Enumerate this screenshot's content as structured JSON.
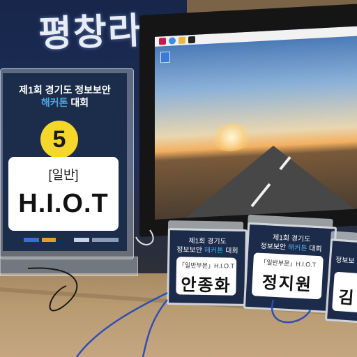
{
  "banner": {
    "text": "평창라"
  },
  "monitor": {
    "desktop": "road-sunset-wallpaper"
  },
  "sign": {
    "title_line1": "제1회 경기도 정보보안",
    "title_hl": "해커톤",
    "title_rest": " 대회",
    "number": "5",
    "category": "[일반]",
    "team": "H.I.O.T"
  },
  "badges": [
    {
      "title_line1": "제1회 경기도",
      "title_pre": "정보보안 ",
      "title_hl": "해커톤",
      "title_post": " 대회",
      "subtitle": "「일반부문」H.I.O.T",
      "name": "안종화"
    },
    {
      "title_line1": "제1회 경기도",
      "title_pre": "정보보안 ",
      "title_hl": "해커톤",
      "title_post": " 대회",
      "subtitle": "「일반부문」H.I.O.T",
      "name": "정지원"
    },
    {
      "title_line1": "",
      "title_pre": "정보보",
      "title_hl": "",
      "title_post": "",
      "subtitle": "",
      "name": "김"
    }
  ],
  "colors": {
    "accent": "#4fa3e0",
    "number_badge": "#f4d72a",
    "sign_bg": "#1b2d4b"
  }
}
